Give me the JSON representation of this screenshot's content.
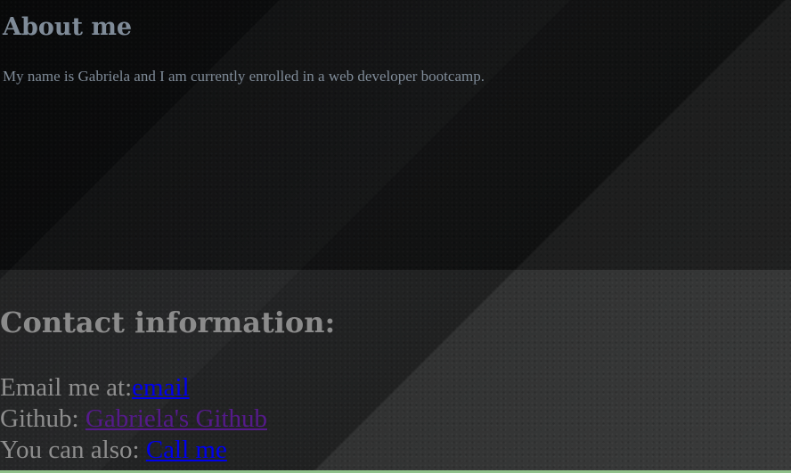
{
  "about": {
    "heading": "About me",
    "text": "My name is Gabriela and I am currently enrolled in a web developer bootcamp."
  },
  "contact": {
    "heading": "Contact information:",
    "email": {
      "prefix": "Email me at:",
      "link_text": "email"
    },
    "github": {
      "prefix": "Github: ",
      "link_text": "Gabriela's Github"
    },
    "phone": {
      "prefix": "You can also: ",
      "link_text": "Call me"
    }
  },
  "colors": {
    "link_unvisited": "#0000ee",
    "link_visited": "#551a8b",
    "heading_about": "#7f8b98",
    "heading_contact": "#8b8b8b",
    "footer_bar": "#8fc08a"
  }
}
